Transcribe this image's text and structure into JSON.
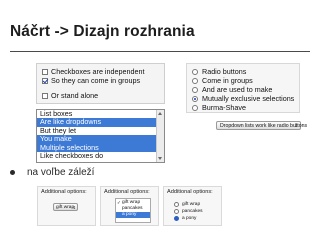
{
  "slide": {
    "title": "Náčrt -> Dizajn rozhrania",
    "bullet": "na voľbe záleží"
  },
  "checkbox_panel": {
    "items": [
      {
        "label": "Checkboxes are independent",
        "checked": false
      },
      {
        "label": "So they can come in groups",
        "checked": true
      },
      {
        "label": "Or stand alone",
        "checked": false
      }
    ]
  },
  "list_box": {
    "items": [
      {
        "label": "List boxes",
        "selected": false
      },
      {
        "label": "Are like dropdowns",
        "selected": true
      },
      {
        "label": "But they let",
        "selected": false
      },
      {
        "label": "You make",
        "selected": true
      },
      {
        "label": "Multiple selections",
        "selected": true
      },
      {
        "label": "Like checkboxes do",
        "selected": false
      }
    ]
  },
  "radio_panel": {
    "items": [
      {
        "label": "Radio buttons",
        "checked": false
      },
      {
        "label": "Come in groups",
        "checked": false
      },
      {
        "label": "And are used to make",
        "checked": false
      },
      {
        "label": "Mutually exclusive selections",
        "checked": true
      },
      {
        "label": "Burma-Shave",
        "checked": false
      }
    ]
  },
  "dropdown_example": {
    "value": "Dropdown lists work like radio buttons"
  },
  "additional_options": {
    "label": "Additional options:",
    "dropdown_value": "gift wrap",
    "list_options": [
      {
        "label": "gift wrap",
        "checked": true,
        "selected": false
      },
      {
        "label": "pancakes",
        "checked": false,
        "selected": false
      },
      {
        "label": "a pony",
        "checked": false,
        "selected": true
      }
    ],
    "radio_options": [
      {
        "label": "gift wrap",
        "checked": false
      },
      {
        "label": "pancakes",
        "checked": false
      },
      {
        "label": "a pony",
        "checked": true
      }
    ]
  },
  "colors": {
    "selection": "#3d7ad6",
    "title_text": "#1d1d1d",
    "check_mark": "#1b3fb5"
  }
}
